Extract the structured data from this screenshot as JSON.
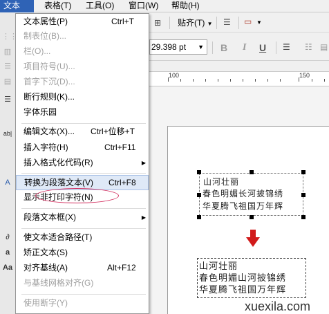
{
  "menubar": {
    "items": [
      "文本(X)",
      "表格(T)",
      "工具(O)",
      "窗口(W)",
      "帮助(H)"
    ]
  },
  "toolbar": {
    "snap_label": "贴齐(T)",
    "font_size_value": "29.398 pt",
    "bold_label": "B",
    "italic_label": "I",
    "underline_label": "U"
  },
  "ruler": {
    "labels": [
      "100",
      "150"
    ]
  },
  "menu": {
    "items": [
      {
        "label": "文本属性(P)",
        "shortcut": "Ctrl+T",
        "enabled": true
      },
      {
        "label": "制表位(B)...",
        "shortcut": "",
        "enabled": false
      },
      {
        "label": "栏(O)...",
        "shortcut": "",
        "enabled": false
      },
      {
        "label": "项目符号(U)...",
        "shortcut": "",
        "enabled": false
      },
      {
        "label": "首字下沉(D)...",
        "shortcut": "",
        "enabled": false
      },
      {
        "label": "断行规则(K)...",
        "shortcut": "",
        "enabled": true
      },
      {
        "label": "字体乐园",
        "shortcut": "",
        "enabled": true
      },
      {
        "label": "编辑文本(X)...",
        "shortcut": "Ctrl+位移+T",
        "enabled": true
      },
      {
        "label": "插入字符(H)",
        "shortcut": "Ctrl+F11",
        "enabled": true
      },
      {
        "label": "插入格式化代码(R)",
        "shortcut": "",
        "enabled": true
      },
      {
        "label": "转换为段落文本(V)",
        "shortcut": "Ctrl+F8",
        "enabled": true
      },
      {
        "label": "显示非打印字符(N)",
        "shortcut": "",
        "enabled": true
      },
      {
        "label": "段落文本框(X)",
        "shortcut": "",
        "enabled": true
      },
      {
        "label": "使文本适合路径(T)",
        "shortcut": "",
        "enabled": true
      },
      {
        "label": "矫正文本(S)",
        "shortcut": "",
        "enabled": true
      },
      {
        "label": "对齐基线(A)",
        "shortcut": "Alt+F12",
        "enabled": true
      },
      {
        "label": "与基线网格对齐(G)",
        "shortcut": "",
        "enabled": false
      },
      {
        "label": "使用断字(Y)",
        "shortcut": "",
        "enabled": false
      }
    ]
  },
  "artistic_text": {
    "lines": [
      "山河壮丽",
      "春色明媚长河披锦绣",
      "华夏腾飞祖国万年辉"
    ]
  },
  "paragraph_text": {
    "lines": [
      "山河壮丽",
      "春色明媚山河披锦绣",
      "华夏腾飞祖国万年辉"
    ]
  },
  "watermark": "xuexila.com",
  "colors": {
    "menu_highlight": "#2f63b6",
    "annotation": "#d32f5f",
    "arrow": "#d11a1a"
  }
}
